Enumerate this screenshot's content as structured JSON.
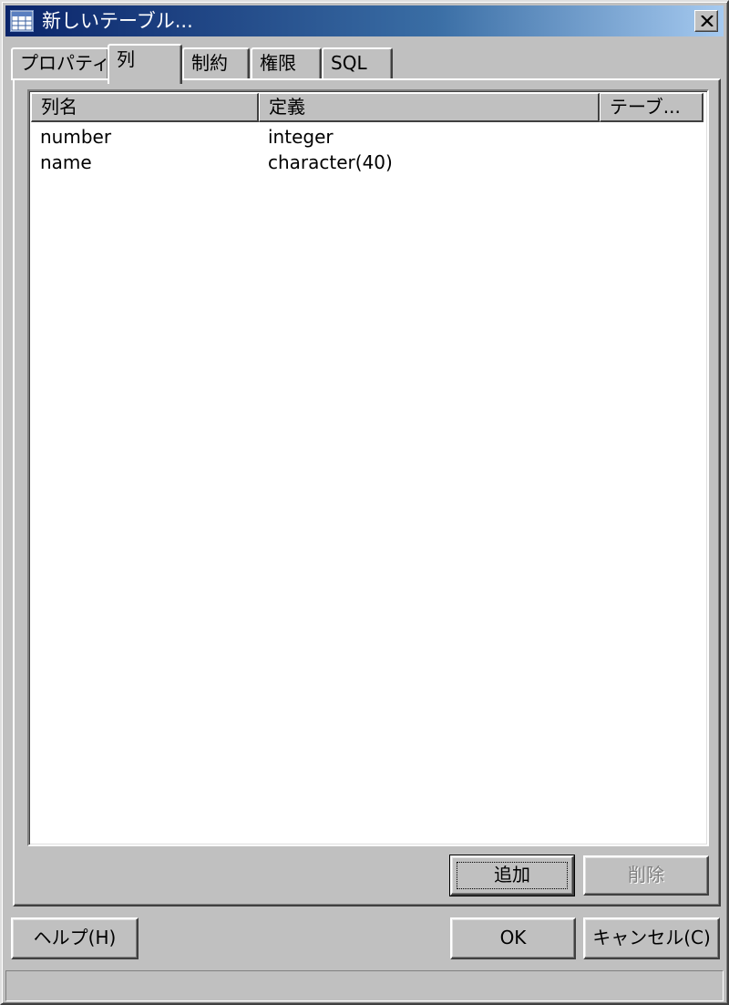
{
  "window": {
    "title": "新しいテーブル...",
    "icon": "table-icon",
    "close_icon": "close-icon"
  },
  "tabs": [
    {
      "label": "プロパティ",
      "active": false
    },
    {
      "label": "列",
      "active": true
    },
    {
      "label": "制約",
      "active": false
    },
    {
      "label": "権限",
      "active": false
    },
    {
      "label": "SQL",
      "active": false
    }
  ],
  "columns_table": {
    "headers": [
      "列名",
      "定義",
      "テーブ..."
    ],
    "rows": [
      {
        "name": "number",
        "definition": "integer",
        "table": ""
      },
      {
        "name": "name",
        "definition": "character(40)",
        "table": ""
      }
    ]
  },
  "panel_buttons": {
    "add_label": "追加",
    "delete_label": "削除",
    "delete_enabled": false
  },
  "dialog_buttons": {
    "help_label": "ヘルプ(H)",
    "ok_label": "OK",
    "cancel_label": "キャンセル(C)"
  },
  "colors": {
    "titlebar_start": "#0a246a",
    "titlebar_end": "#a6caf0",
    "face": "#c0c0c0"
  }
}
